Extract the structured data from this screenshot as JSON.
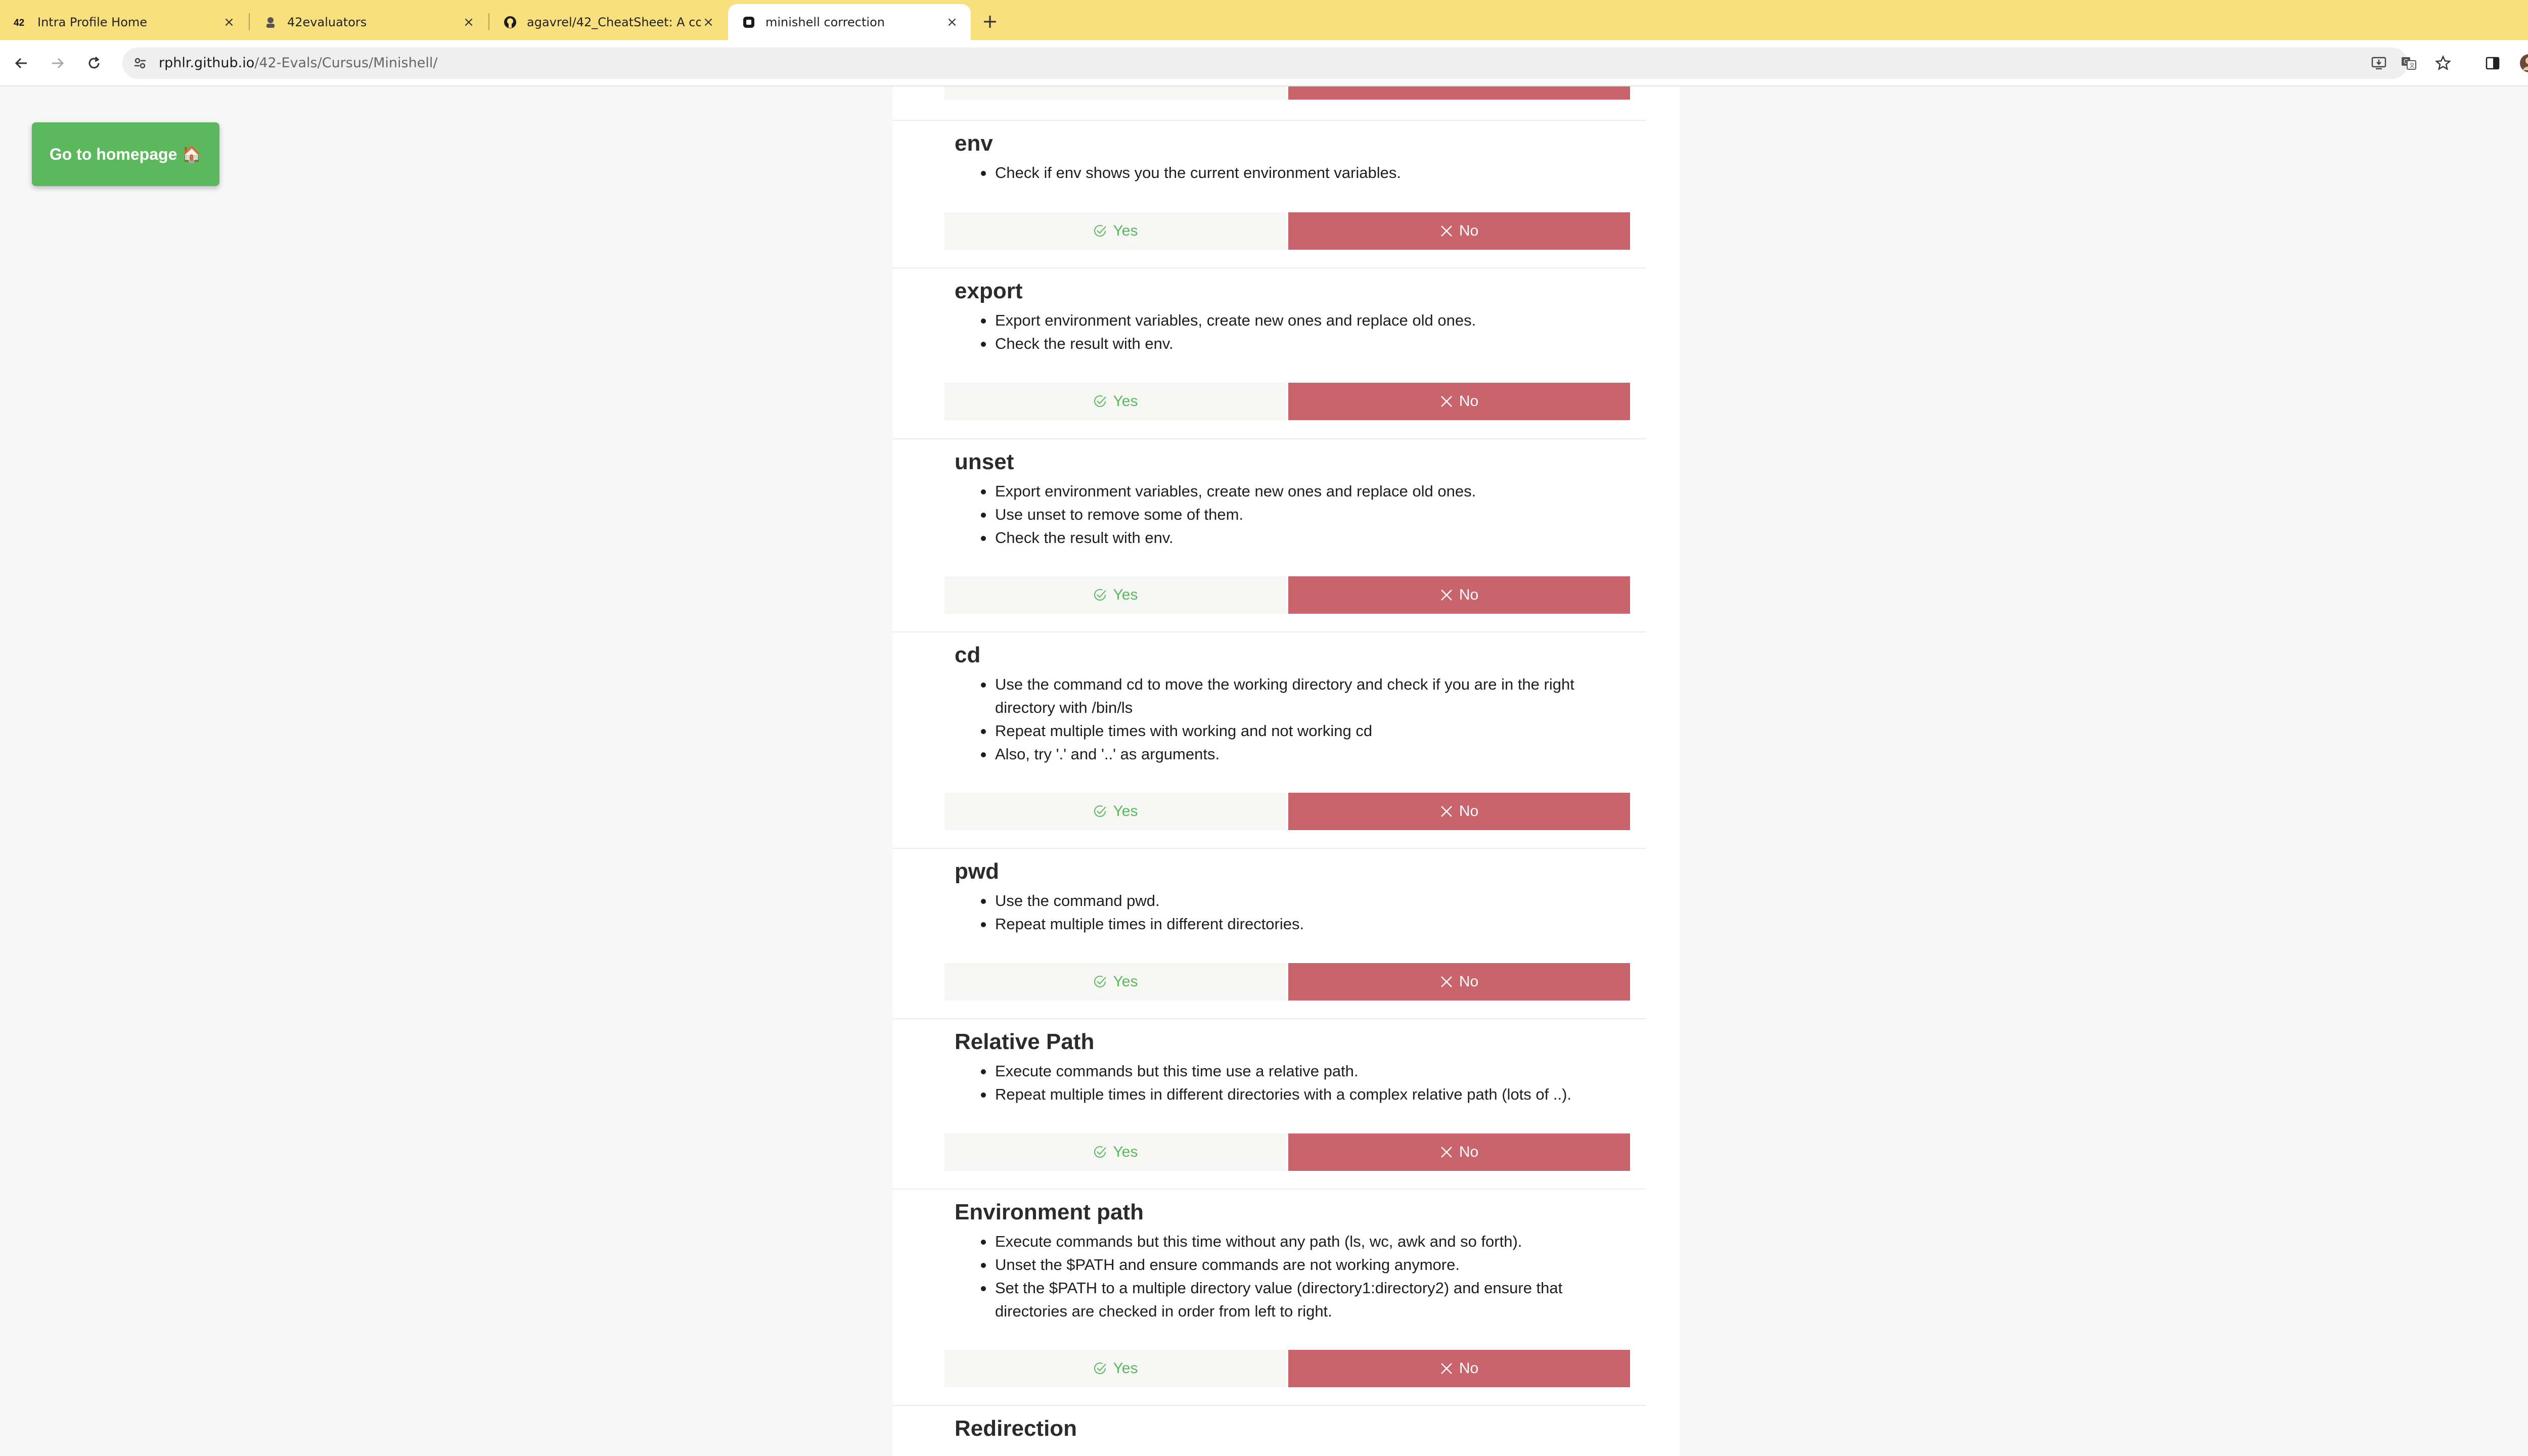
{
  "browser": {
    "tabs": [
      {
        "title": "Intra Profile Home",
        "favicon": "42-logo-icon"
      },
      {
        "title": "42evaluators",
        "favicon": "42evaluators-icon"
      },
      {
        "title": "agavrel/42_CheatSheet: A co",
        "favicon": "github-icon"
      },
      {
        "title": "minishell correction",
        "favicon": "site-icon"
      }
    ],
    "active_tab": 3,
    "new_tab": "+",
    "url_host": "rphlr.github.io",
    "url_path": "/42-Evals/Cursus/Minishell/"
  },
  "page": {
    "home_button": "Go to homepage 🏠",
    "yes_label": "Yes",
    "no_label": "No",
    "colors": {
      "yes_text": "#5cb85c",
      "no_bg": "#c9636c",
      "home_bg": "#5cb85c"
    },
    "sections": [
      {
        "title": "env",
        "items": [
          "Check if env shows you the current environment variables."
        ]
      },
      {
        "title": "export",
        "items": [
          "Export environment variables, create new ones and replace old ones.",
          "Check the result with env."
        ]
      },
      {
        "title": "unset",
        "items": [
          "Export environment variables, create new ones and replace old ones.",
          "Use unset to remove some of them.",
          "Check the result with env."
        ]
      },
      {
        "title": "cd",
        "items": [
          "Use the command cd to move the working directory and check if you are in the right directory with /bin/ls",
          "Repeat multiple times with working and not working cd",
          "Also, try '.' and '..' as arguments."
        ]
      },
      {
        "title": "pwd",
        "items": [
          "Use the command pwd.",
          "Repeat multiple times in different directories."
        ]
      },
      {
        "title": "Relative Path",
        "items": [
          "Execute commands but this time use a relative path.",
          "Repeat multiple times in different directories with a complex relative path (lots of ..)."
        ]
      },
      {
        "title": "Environment path",
        "items": [
          "Execute commands but this time without any path (ls, wc, awk and so forth).",
          "Unset the $PATH and ensure commands are not working anymore.",
          "Set the $PATH to a multiple directory value (directory1:directory2) and ensure that directories are checked in order from left to right."
        ]
      },
      {
        "title": "Redirection",
        "items": []
      }
    ]
  }
}
